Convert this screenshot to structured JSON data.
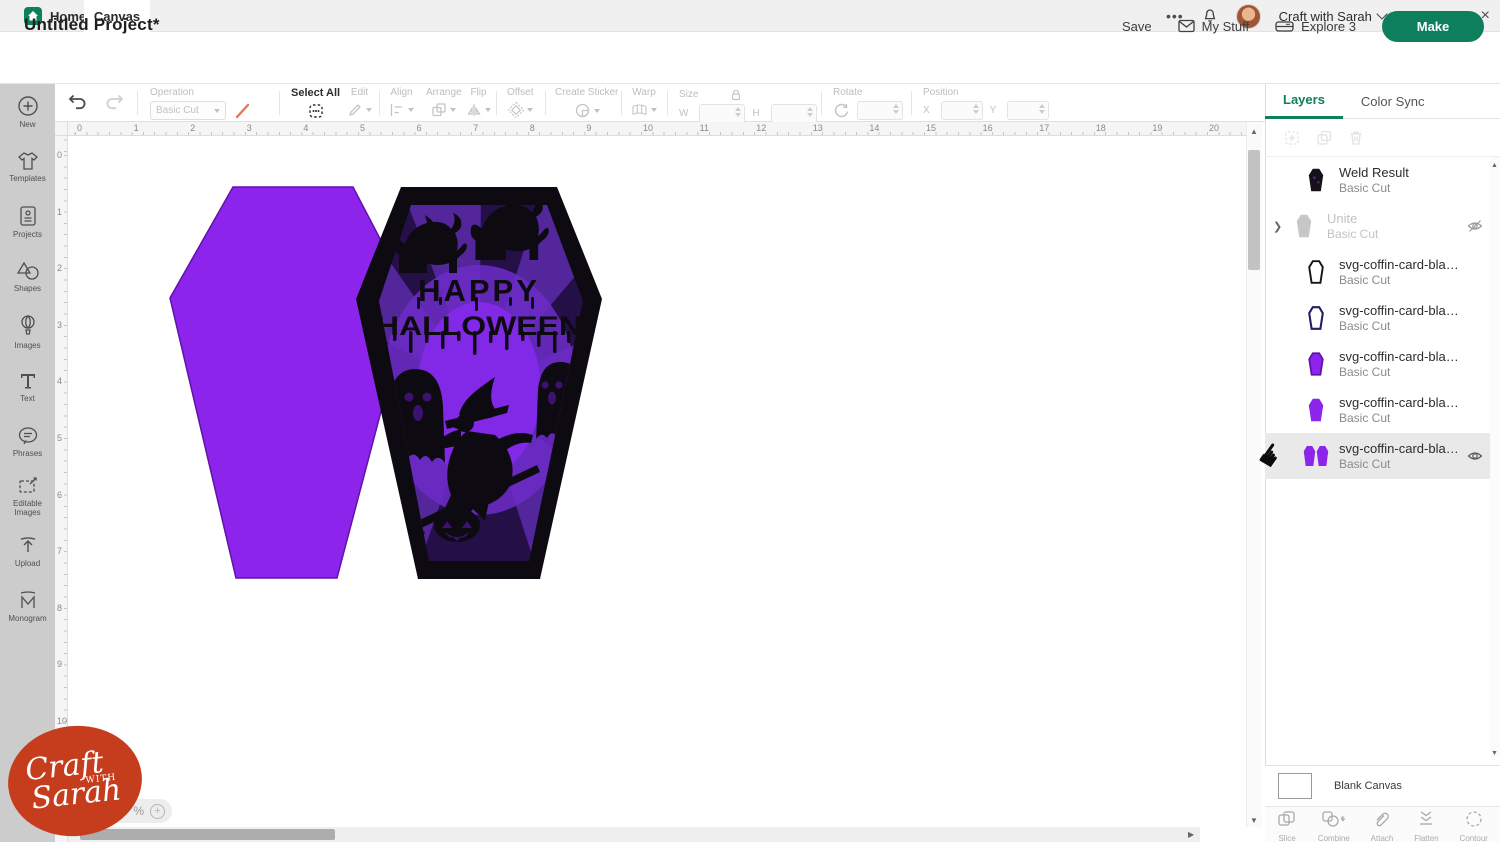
{
  "titlebar": {
    "home_label": "Home",
    "canvas_label": "Canvas",
    "overflow": "•••",
    "account_name": "Craft with Sarah"
  },
  "header": {
    "project_title": "Untitled Project*",
    "save_label": "Save",
    "my_stuff_label": "My Stuff",
    "explore_label": "Explore 3",
    "make_label": "Make"
  },
  "toolbar": {
    "operation_label": "Operation",
    "operation_value": "Basic Cut",
    "select_all_label": "Select All",
    "edit_label": "Edit",
    "align_label": "Align",
    "arrange_label": "Arrange",
    "flip_label": "Flip",
    "offset_label": "Offset",
    "create_sticker_label": "Create Sticker",
    "warp_label": "Warp",
    "size_label": "Size",
    "w_label": "W",
    "h_label": "H",
    "rotate_label": "Rotate",
    "position_label": "Position",
    "x_label": "X",
    "y_label": "Y"
  },
  "sidebar": {
    "items": [
      {
        "label": "New",
        "icon": "new-icon"
      },
      {
        "label": "Templates",
        "icon": "templates-icon"
      },
      {
        "label": "Projects",
        "icon": "projects-icon"
      },
      {
        "label": "Shapes",
        "icon": "shapes-icon"
      },
      {
        "label": "Images",
        "icon": "images-icon"
      },
      {
        "label": "Text",
        "icon": "text-icon"
      },
      {
        "label": "Phrases",
        "icon": "phrases-icon"
      },
      {
        "label": "Editable Images",
        "icon": "editable-images-icon"
      },
      {
        "label": "Upload",
        "icon": "upload-icon"
      },
      {
        "label": "Monogram",
        "icon": "monogram-icon"
      }
    ]
  },
  "canvas": {
    "h_ruler": [
      "0",
      "1",
      "2",
      "3",
      "4",
      "5",
      "6",
      "7",
      "8",
      "9",
      "10",
      "11",
      "12",
      "13",
      "14",
      "15",
      "16",
      "17",
      "18",
      "19",
      "20"
    ],
    "v_ruler": [
      "0",
      "1",
      "2",
      "3",
      "4",
      "5",
      "6",
      "7",
      "8",
      "9",
      "10"
    ],
    "card_text_1": "HAPPY",
    "card_text_2": "HALLOWEEN",
    "zoom_suffix": "%"
  },
  "layers_panel": {
    "tabs": [
      "Layers",
      "Color Sync"
    ],
    "rows": [
      {
        "name": "Weld Result",
        "sub": "Basic Cut",
        "thumb": "weld",
        "dim": false,
        "chev": false,
        "eye": "none",
        "selected": false
      },
      {
        "name": "Unite",
        "sub": "Basic Cut",
        "thumb": "unite",
        "dim": true,
        "chev": true,
        "eye": "hidden",
        "selected": false
      },
      {
        "name": "svg-coffin-card-blank-cr...",
        "sub": "Basic Cut",
        "thumb": "outline-black",
        "dim": false,
        "chev": false,
        "eye": "none",
        "selected": false
      },
      {
        "name": "svg-coffin-card-blank-cr...",
        "sub": "Basic Cut",
        "thumb": "outline-navy",
        "dim": false,
        "chev": false,
        "eye": "none",
        "selected": false
      },
      {
        "name": "svg-coffin-card-blank-cr...",
        "sub": "Basic Cut",
        "thumb": "purple-outline",
        "dim": false,
        "chev": false,
        "eye": "none",
        "selected": false
      },
      {
        "name": "svg-coffin-card-blank-cr...",
        "sub": "Basic Cut",
        "thumb": "purple-solid",
        "dim": false,
        "chev": false,
        "eye": "none",
        "selected": false
      },
      {
        "name": "svg-coffin-card-blan...",
        "sub": "Basic Cut",
        "thumb": "purple-double",
        "dim": false,
        "chev": false,
        "eye": "visible",
        "selected": true
      }
    ],
    "blank_canvas_label": "Blank Canvas",
    "actions": [
      {
        "label": "Slice",
        "icon": "slice-icon"
      },
      {
        "label": "Combine",
        "icon": "combine-icon"
      },
      {
        "label": "Attach",
        "icon": "attach-icon"
      },
      {
        "label": "Flatten",
        "icon": "flatten-icon"
      },
      {
        "label": "Contour",
        "icon": "contour-icon"
      }
    ]
  },
  "logo": {
    "line1": "Craft",
    "line2": "WITH",
    "line3": "Sarah"
  },
  "colors": {
    "brand_green": "#0e7f5c",
    "shape_purple": "#8c24eb",
    "card_black": "#0e0a12",
    "logo_red": "#c63d1e",
    "selected_row": "#e9e9e9"
  }
}
